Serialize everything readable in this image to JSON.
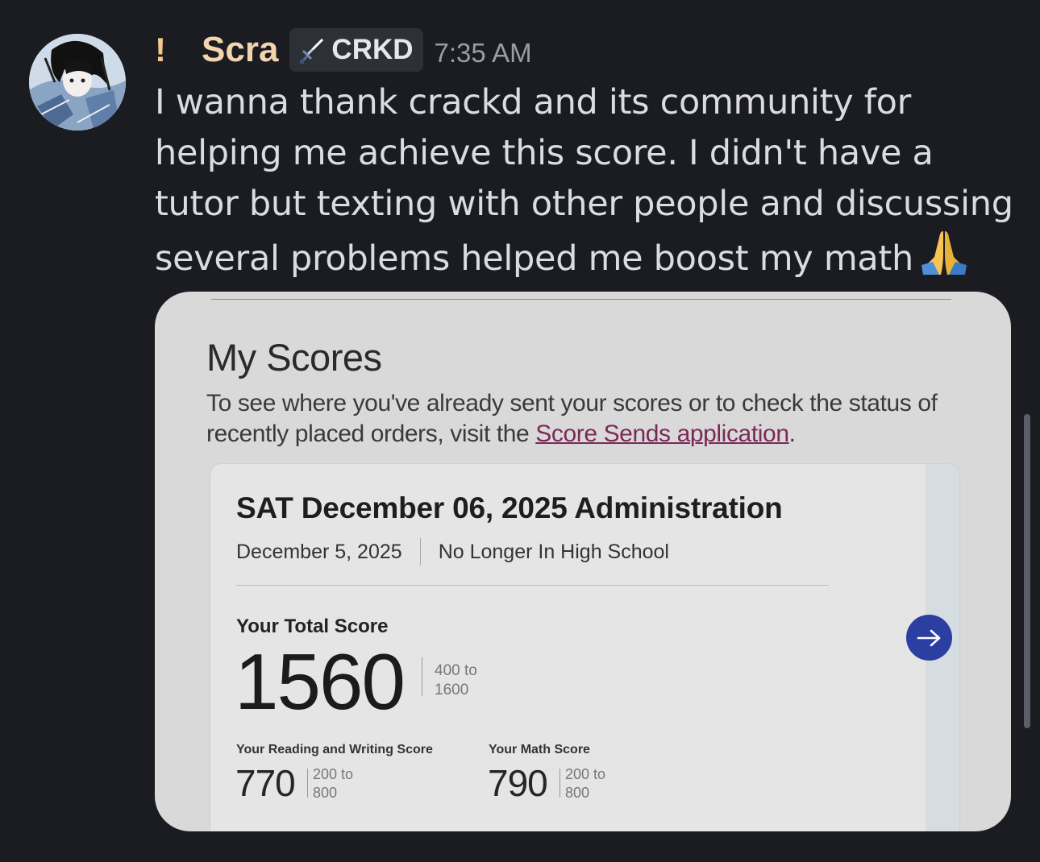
{
  "message": {
    "prefix": "!",
    "username": "Scra",
    "tag": {
      "icon": "sword-icon",
      "label": "CRKD"
    },
    "timestamp": "7:35 AM",
    "text": "I wanna thank crackd and its community for helping me achieve this score. I didn't have a tutor but texting with other people and discussing several problems helped me boost my math",
    "emoji": "folded-hands"
  },
  "embed": {
    "title": "My Scores",
    "description_prefix": "To see where you've already sent your scores or to check the status of recently placed orders, visit the ",
    "link_text": "Score Sends application",
    "description_suffix": ".",
    "card": {
      "exam_name": "SAT December 06, 2025 Administration",
      "date": "December 5, 2025",
      "status": "No Longer In High School",
      "total_label": "Your Total Score",
      "total_score": "1560",
      "total_range_line1": "400 to",
      "total_range_line2": "1600",
      "rw_label": "Your Reading and Writing Score",
      "rw_score": "770",
      "rw_range_line1": "200 to",
      "rw_range_line2": "800",
      "math_label": "Your Math Score",
      "math_score": "790",
      "math_range_line1": "200 to",
      "math_range_line2": "800"
    }
  },
  "colors": {
    "background": "#1b1c22",
    "username": "#f2d4ae",
    "link": "#7b2a57",
    "next_button": "#2b3fa3"
  }
}
